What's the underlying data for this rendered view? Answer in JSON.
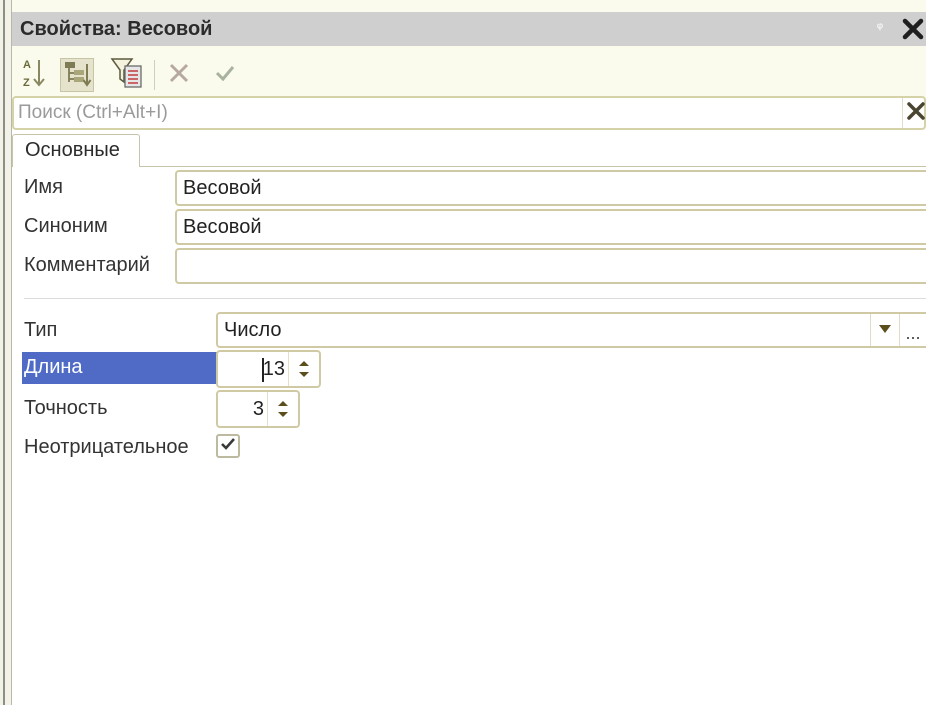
{
  "window": {
    "title": "Свойства: Весовой",
    "pin_glyph": "ᵠ"
  },
  "search": {
    "placeholder": "Поиск (Ctrl+Alt+I)",
    "value": ""
  },
  "tabs": [
    {
      "label": "Основные"
    }
  ],
  "fields": {
    "name": {
      "label": "Имя",
      "value": "Весовой"
    },
    "synonym": {
      "label": "Синоним",
      "value": "Весовой"
    },
    "comment": {
      "label": "Комментарий",
      "value": ""
    },
    "type": {
      "label": "Тип",
      "value": "Число",
      "more": "..."
    },
    "length": {
      "label": "Длина",
      "value": "13"
    },
    "precision": {
      "label": "Точность",
      "value": "3"
    },
    "nonnegative": {
      "label": "Неотрицательное",
      "checked": true
    }
  },
  "toolbar": {
    "icons": [
      "sort-alphabetical-icon",
      "group-by-category-icon",
      "filter-list-icon",
      "cancel-x-icon",
      "confirm-check-icon"
    ]
  },
  "colors": {
    "title_bg": "#cfcfcf",
    "toolbar_bg": "#fbfbed",
    "field_border": "#cfcaa3",
    "highlight": "#4f6bc6",
    "icon_olive": "#6b6a3c"
  }
}
